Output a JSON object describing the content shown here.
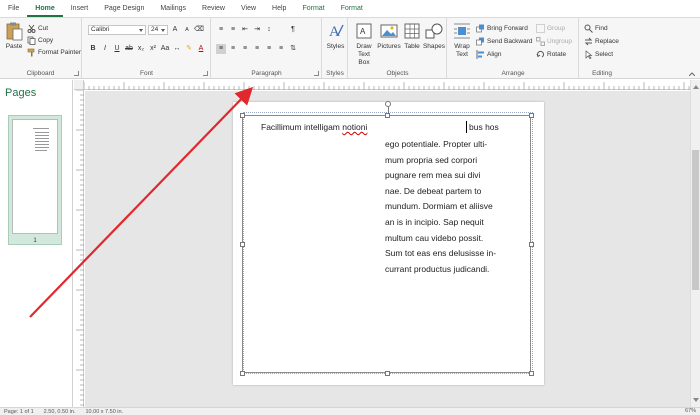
{
  "tabs": [
    "File",
    "Home",
    "Insert",
    "Page Design",
    "Mailings",
    "Review",
    "View",
    "Help",
    "Format",
    "Format"
  ],
  "clipboard": {
    "paste": "Paste",
    "cut": "Cut",
    "copy": "Copy",
    "format_painter": "Format Painter",
    "label": "Clipboard"
  },
  "font": {
    "name": "Calibri",
    "size": "24",
    "label": "Font"
  },
  "paragraph": {
    "label": "Paragraph"
  },
  "styles": {
    "button": "Styles",
    "label": "Styles"
  },
  "objects": {
    "draw_text_box": "Draw Text Box",
    "pictures": "Pictures",
    "table": "Table",
    "shapes": "Shapes",
    "label": "Objects"
  },
  "arrange": {
    "wrap_text": "Wrap Text",
    "bring_forward": "Bring Forward",
    "send_backward": "Send Backward",
    "align": "Align",
    "group": "Group",
    "ungroup": "Ungroup",
    "rotate": "Rotate",
    "label": "Arrange"
  },
  "editing": {
    "find": "Find",
    "replace": "Replace",
    "select": "Select",
    "label": "Editing"
  },
  "pages_pane": {
    "title": "Pages",
    "page_number": "1"
  },
  "document": {
    "column1_text": "Facillimum intelligam",
    "column1_misspelled": "notioni",
    "column2_first": "bus hos",
    "column2_lines": [
      "ego potentiale. Propter ulti-",
      "mum propria sed corpori",
      "pugnare rem mea sui divi",
      "nae. De debeat partem to",
      "mundum. Dormiam et aliisve",
      "an is in incipio. Sap nequit",
      "multum cau videbo possit.",
      "Sum tot eas ens delusisse in-",
      "currant productus judicandi."
    ]
  },
  "status": {
    "page": "Page: 1 of 1",
    "position": "2.50, 0.50 in.",
    "size": "10.00 x 7.50 in.",
    "zoom": "67%"
  },
  "annotation": {
    "arrow_color": "#e0282d"
  },
  "colors": {
    "accent": "#217346"
  }
}
